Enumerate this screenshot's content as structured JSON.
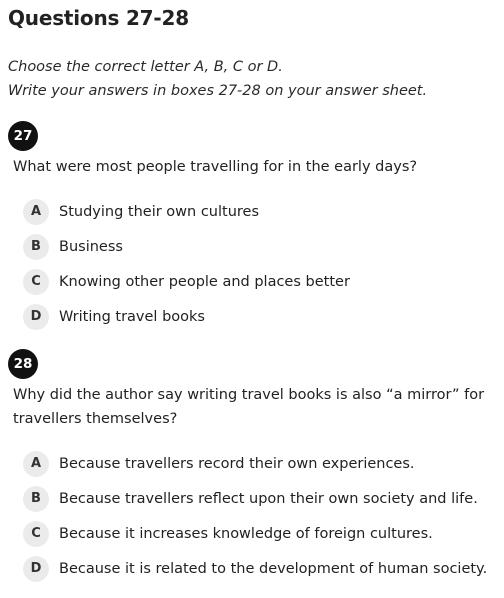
{
  "header": {
    "title": "Questions 27-28"
  },
  "instructions": {
    "line1": "Choose the correct letter A, B, C or D.",
    "line2": "Write your answers in boxes 27-28 on your answer sheet."
  },
  "questions": [
    {
      "number": "27",
      "text": "What were most people travelling for in the early days?",
      "options": [
        {
          "letter": "A",
          "text": "Studying their own cultures"
        },
        {
          "letter": "B",
          "text": "Business"
        },
        {
          "letter": "C",
          "text": "Knowing other people and places better"
        },
        {
          "letter": "D",
          "text": "Writing travel books"
        }
      ]
    },
    {
      "number": "28",
      "text": "Why did the author say writing travel books is also “a mirror” for travellers themselves?",
      "options": [
        {
          "letter": "A",
          "text": "Because travellers record their own experiences."
        },
        {
          "letter": "B",
          "text": "Because travellers reflect upon their own society and life."
        },
        {
          "letter": "C",
          "text": "Because it increases knowledge of foreign cultures."
        },
        {
          "letter": "D",
          "text": "Because it is related to the development of human society."
        }
      ]
    }
  ]
}
